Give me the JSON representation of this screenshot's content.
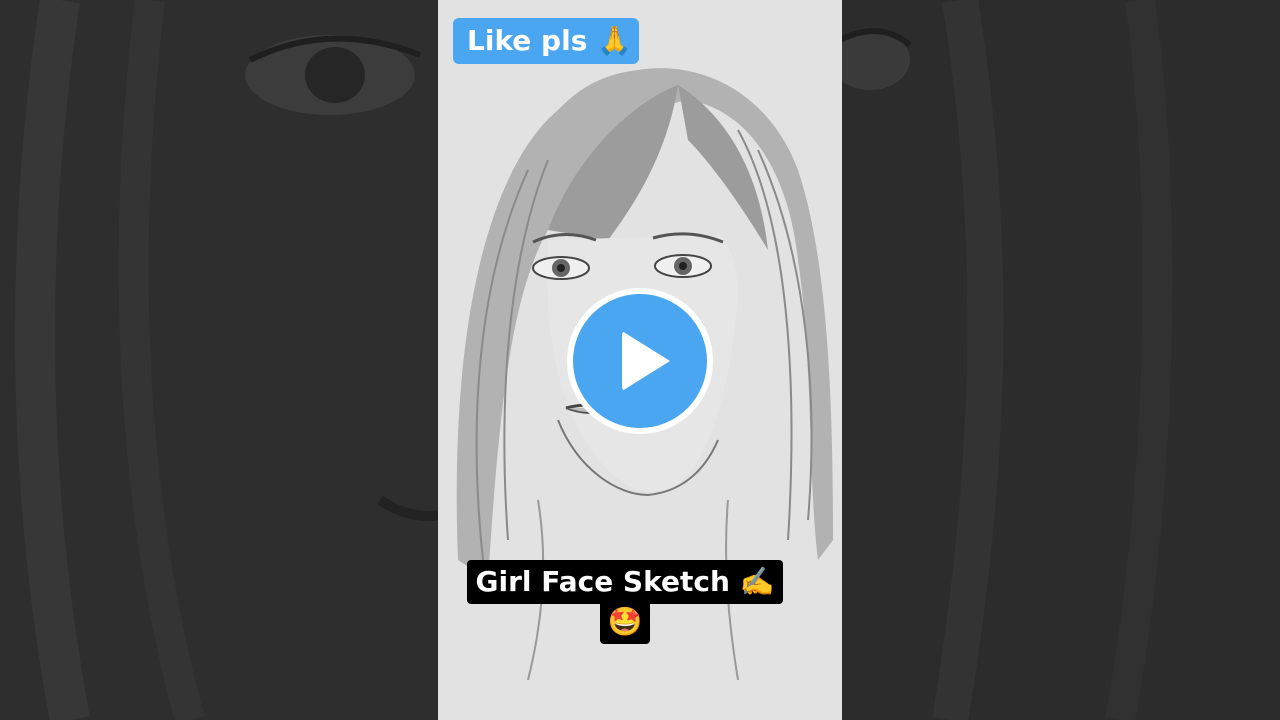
{
  "overlay": {
    "like_badge": "Like pls 🙏",
    "caption_line1": "Girl Face Sketch ✍️",
    "caption_line2": "🤩"
  },
  "controls": {
    "play_icon": "play-icon"
  },
  "colors": {
    "accent": "#4aa6f0",
    "caption_bg": "#000000",
    "paper": "#e4e4e4",
    "side_bg": "#2b2b2b"
  }
}
